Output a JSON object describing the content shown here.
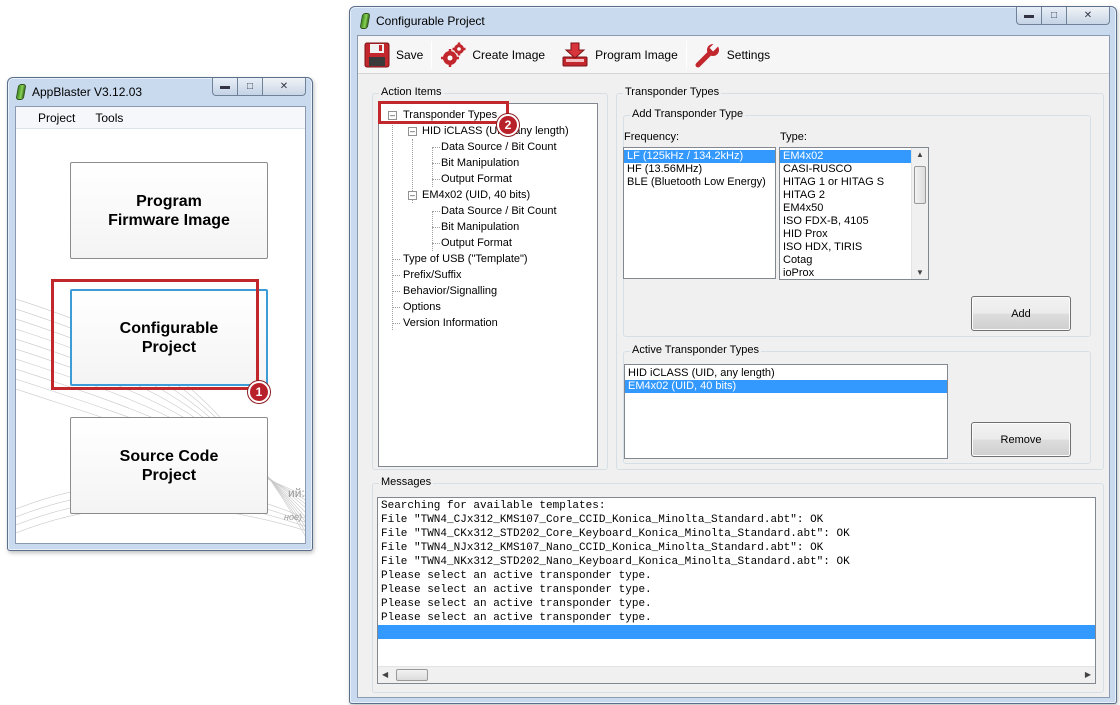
{
  "left_window": {
    "title": "AppBlaster V3.12.03",
    "menu": [
      "Project",
      "Tools"
    ],
    "tiles": [
      {
        "label": "Program\nFirmware Image"
      },
      {
        "label": "Configurable\nProject"
      },
      {
        "label": "Source Code\nProject"
      }
    ],
    "callout_1": "1",
    "faint_text_1": "ий:",
    "faint_text_2": "ное)"
  },
  "right_window": {
    "title": "Configurable Project",
    "toolbar": {
      "save": "Save",
      "create_image": "Create Image",
      "program_image": "Program Image",
      "settings": "Settings"
    },
    "action_items": {
      "group_label": "Action Items",
      "callout_2": "2",
      "tree": [
        {
          "label": "Transponder Types"
        },
        {
          "label": "HID iCLASS (UID, any length)"
        },
        {
          "label": "Data Source / Bit Count"
        },
        {
          "label": "Bit Manipulation"
        },
        {
          "label": "Output Format"
        },
        {
          "label": "EM4x02 (UID, 40 bits)"
        },
        {
          "label": "Data Source / Bit Count"
        },
        {
          "label": "Bit Manipulation"
        },
        {
          "label": "Output Format"
        },
        {
          "label": "Type of USB (\"Template\")"
        },
        {
          "label": "Prefix/Suffix"
        },
        {
          "label": "Behavior/Signalling"
        },
        {
          "label": "Options"
        },
        {
          "label": "Version Information"
        }
      ]
    },
    "transponder_types": {
      "group_label": "Transponder Types",
      "add_group_label": "Add Transponder Type",
      "frequency_label": "Frequency:",
      "type_label": "Type:",
      "frequencies": [
        "LF (125kHz / 134.2kHz)",
        "HF (13.56MHz)",
        "BLE (Bluetooth Low Energy)"
      ],
      "frequency_selected": 0,
      "types": [
        "EM4x02",
        "CASI-RUSCO",
        "HITAG 1 or HITAG S",
        "HITAG 2",
        "EM4x50",
        "ISO FDX-B, 4105",
        "HID Prox",
        "ISO HDX, TIRIS",
        "Cotag",
        "ioProx"
      ],
      "type_selected": 0,
      "add_button": "Add",
      "active_group_label": "Active Transponder Types",
      "active": [
        "HID iCLASS (UID, any length)",
        "EM4x02 (UID, 40 bits)"
      ],
      "active_selected": 1,
      "remove_button": "Remove"
    },
    "messages": {
      "group_label": "Messages",
      "lines": [
        "Searching for available templates:",
        "File \"TWN4_CJx312_KMS107_Core_CCID_Konica_Minolta_Standard.abt\": OK",
        "File \"TWN4_CKx312_STD202_Core_Keyboard_Konica_Minolta_Standard.abt\": OK",
        "File \"TWN4_NJx312_KMS107_Nano_CCID_Konica_Minolta_Standard.abt\": OK",
        "File \"TWN4_NKx312_STD202_Nano_Keyboard_Konica_Minolta_Standard.abt\": OK",
        "Please select an active transponder type.",
        "Please select an active transponder type.",
        "Please select an active transponder type.",
        "Please select an active transponder type.",
        ""
      ],
      "selected_line": 9
    }
  },
  "colors": {
    "highlight": "#3399ff",
    "callout_red": "#c0282c",
    "frame_blue": "#c9daee"
  }
}
